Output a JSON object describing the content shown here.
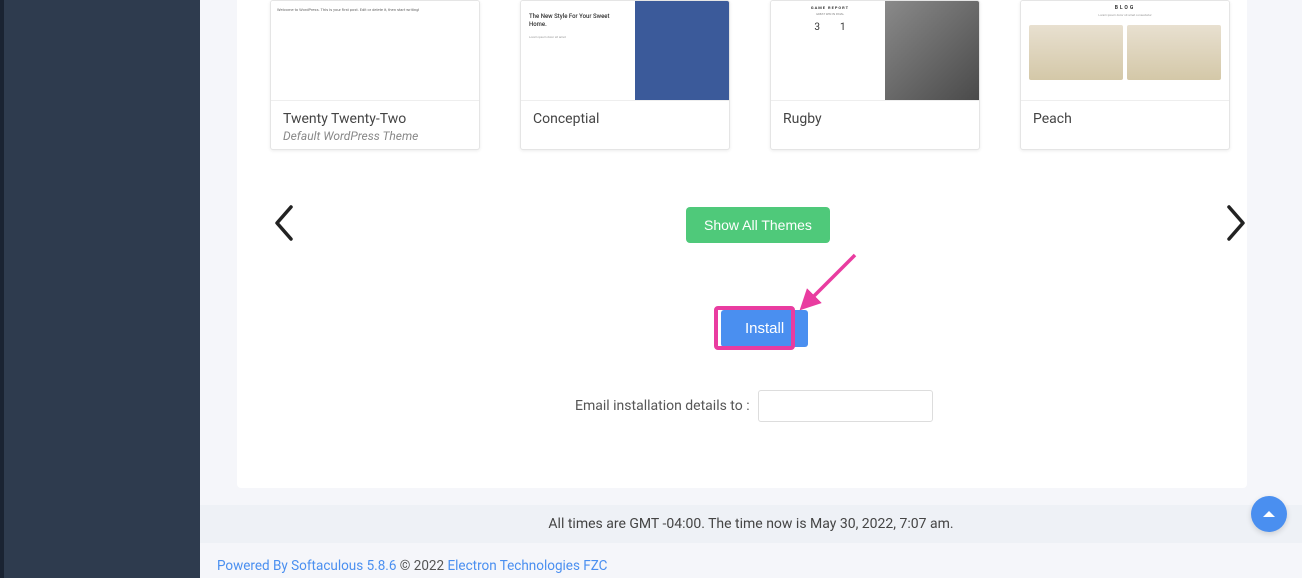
{
  "themes": [
    {
      "name": "Twenty Twenty-Two",
      "subtitle": "Default WordPress Theme"
    },
    {
      "name": "Conceptial",
      "subtitle": ""
    },
    {
      "name": "Rugby",
      "subtitle": ""
    },
    {
      "name": "Peach",
      "subtitle": ""
    }
  ],
  "preview": {
    "conceptial_headline": "The New Style For Your Sweet Home.",
    "rugby_title": "GAME REPORT",
    "rugby_sub": "GREAT WIN IN FINAL",
    "rugby_score_left": "3",
    "rugby_score_right": "1",
    "peach_label": "BLOG"
  },
  "buttons": {
    "show_all": "Show All Themes",
    "install": "Install"
  },
  "email": {
    "label": "Email installation details to :",
    "value": ""
  },
  "footer": {
    "time": "All times are GMT -04:00. The time now is May 30, 2022, 7:07 am.",
    "powered": "Powered By Softaculous 5.8.6",
    "copyright": " © 2022 ",
    "company": "Electron Technologies FZC"
  }
}
